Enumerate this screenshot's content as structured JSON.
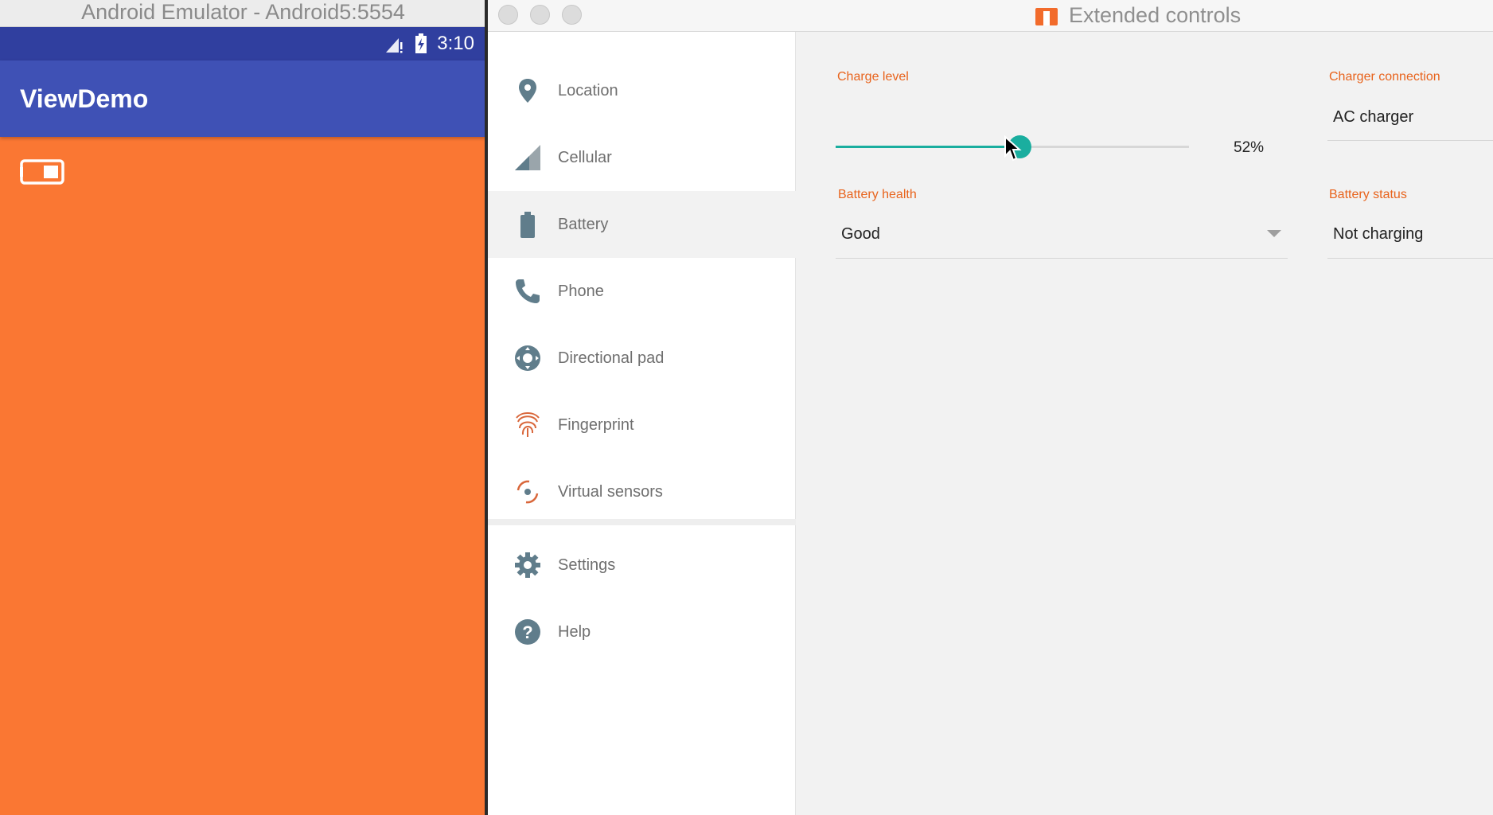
{
  "emulator": {
    "window_title": "Android Emulator - Android5:5554",
    "status_time": "3:10",
    "app_title": "ViewDemo",
    "background_color": "#fa7733",
    "status_icons": [
      "cell-signal-icon",
      "battery-charging-icon"
    ]
  },
  "extended_controls": {
    "window_title": "Extended controls",
    "sidebar": {
      "items": [
        {
          "label": "Location",
          "icon": "location-pin-icon",
          "active": false
        },
        {
          "label": "Cellular",
          "icon": "cellular-signal-icon",
          "active": false
        },
        {
          "label": "Battery",
          "icon": "battery-icon",
          "active": true
        },
        {
          "label": "Phone",
          "icon": "phone-icon",
          "active": false
        },
        {
          "label": "Directional pad",
          "icon": "dpad-icon",
          "active": false
        },
        {
          "label": "Fingerprint",
          "icon": "fingerprint-icon",
          "active": false
        },
        {
          "label": "Virtual sensors",
          "icon": "virtual-sensors-icon",
          "active": false
        },
        {
          "label": "Settings",
          "icon": "gear-icon",
          "active": false
        },
        {
          "label": "Help",
          "icon": "help-icon",
          "active": false
        }
      ]
    },
    "battery": {
      "charge_level_label": "Charge level",
      "charge_level_value": 52,
      "charge_level_text": "52%",
      "charger_connection_label": "Charger connection",
      "charger_connection_value": "AC charger",
      "battery_health_label": "Battery health",
      "battery_health_value": "Good",
      "battery_status_label": "Battery status",
      "battery_status_value": "Not charging"
    },
    "colors": {
      "accent": "#e8631c",
      "slider": "#1aae9f",
      "icon": "#607d8b"
    }
  }
}
